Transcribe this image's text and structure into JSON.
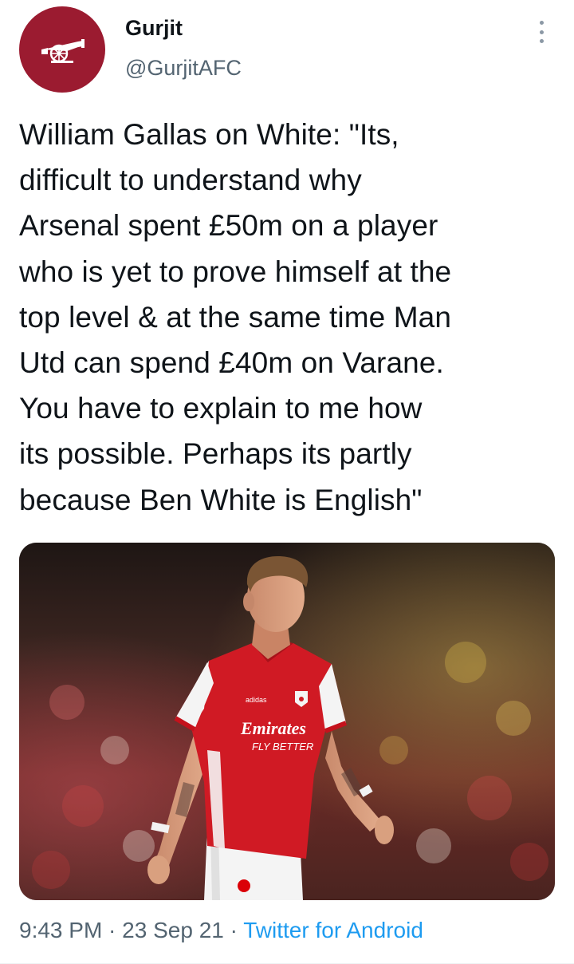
{
  "author": {
    "name": "Gurjit",
    "handle": "@GurjitAFC",
    "avatar_icon": "arsenal-cannon-icon",
    "avatar_color": "#9b1b30"
  },
  "menu_icon": "more-vertical-icon",
  "tweet": {
    "lines": [
      "William Gallas on White: \"Its,",
      "difficult to understand why",
      "Arsenal spent £50m on a player",
      "who is yet to prove himself at the",
      "top level & at the same time Man",
      "Utd can spend £40m on Varane.",
      "You have to explain to me how",
      "its possible. Perhaps its partly",
      "because Ben White is English\""
    ]
  },
  "media": {
    "kit_sponsor": "Emirates",
    "kit_tagline": "FLY BETTER",
    "kit_brand": "adidas"
  },
  "meta": {
    "time": "9:43 PM",
    "separator": " · ",
    "date": "23 Sep 21",
    "source": "Twitter for Android"
  },
  "colors": {
    "text": "#0f1419",
    "secondary": "#536471",
    "link": "#1d9bf0",
    "arsenal_red": "#db0007"
  }
}
